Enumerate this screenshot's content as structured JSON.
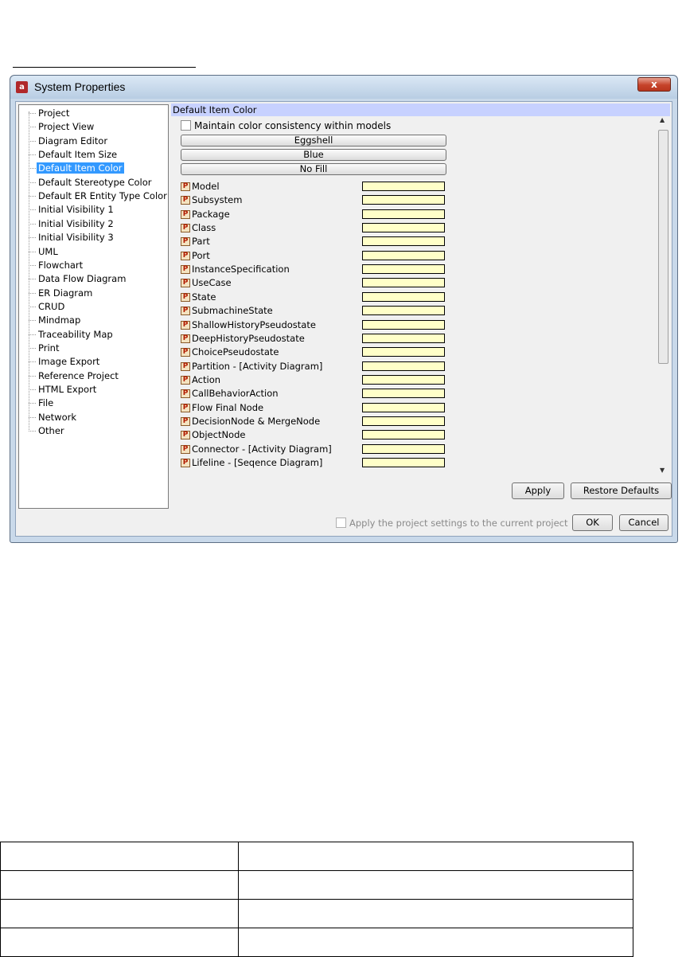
{
  "window": {
    "title": "System Properties",
    "app_icon": "astah-app-icon",
    "close_label": "x"
  },
  "tree": {
    "items": [
      {
        "label": "Project"
      },
      {
        "label": "Project View"
      },
      {
        "label": "Diagram Editor"
      },
      {
        "label": "Default Item Size"
      },
      {
        "label": "Default Item Color",
        "selected": true
      },
      {
        "label": "Default Stereotype Color"
      },
      {
        "label": "Default ER Entity Type Color"
      },
      {
        "label": "Initial Visibility 1"
      },
      {
        "label": "Initial Visibility 2"
      },
      {
        "label": "Initial Visibility 3"
      },
      {
        "label": "UML"
      },
      {
        "label": "Flowchart"
      },
      {
        "label": "Data Flow Diagram"
      },
      {
        "label": "ER Diagram"
      },
      {
        "label": "CRUD"
      },
      {
        "label": "Mindmap"
      },
      {
        "label": "Traceability Map"
      },
      {
        "label": "Print"
      },
      {
        "label": "Image Export"
      },
      {
        "label": "Reference Project"
      },
      {
        "label": "HTML Export"
      },
      {
        "label": "File"
      },
      {
        "label": "Network"
      },
      {
        "label": "Other"
      }
    ]
  },
  "panel": {
    "header": "Default Item Color",
    "consistency_checkbox": {
      "label": "Maintain color consistency within models",
      "checked": false
    },
    "color_buttons": [
      "Eggshell",
      "Blue",
      "No Fill"
    ],
    "items": [
      {
        "label": "Model",
        "color": "#ffffc8"
      },
      {
        "label": "Subsystem",
        "color": "#ffffc8"
      },
      {
        "label": "Package",
        "color": "#ffffc8"
      },
      {
        "label": "Class",
        "color": "#ffffc8"
      },
      {
        "label": "Part",
        "color": "#ffffc8"
      },
      {
        "label": "Port",
        "color": "#ffffc8"
      },
      {
        "label": "InstanceSpecification",
        "color": "#ffffc8"
      },
      {
        "label": "UseCase",
        "color": "#ffffc8"
      },
      {
        "label": "State",
        "color": "#ffffc8"
      },
      {
        "label": "SubmachineState",
        "color": "#ffffc8"
      },
      {
        "label": "ShallowHistoryPseudostate",
        "color": "#ffffc8"
      },
      {
        "label": "DeepHistoryPseudostate",
        "color": "#ffffc8"
      },
      {
        "label": "ChoicePseudostate",
        "color": "#ffffc8"
      },
      {
        "label": "Partition - [Activity Diagram]",
        "color": "#ffffc8"
      },
      {
        "label": "Action",
        "color": "#ffffc8"
      },
      {
        "label": "CallBehaviorAction",
        "color": "#ffffc8"
      },
      {
        "label": "Flow Final Node",
        "color": "#ffffc8"
      },
      {
        "label": "DecisionNode & MergeNode",
        "color": "#ffffc8"
      },
      {
        "label": "ObjectNode",
        "color": "#ffffc8"
      },
      {
        "label": "Connector - [Activity Diagram]",
        "color": "#ffffc8"
      },
      {
        "label": "Lifeline - [Seqence Diagram]",
        "color": "#ffffc8"
      }
    ],
    "item_icon_glyph": "P",
    "apply_label": "Apply",
    "restore_label": "Restore Defaults"
  },
  "footer": {
    "apply_project_checkbox": {
      "label": "Apply the project settings to the current project",
      "checked": false,
      "enabled": false
    },
    "ok_label": "OK",
    "cancel_label": "Cancel"
  },
  "colors": {
    "selection": "#3399ff",
    "panel_header": "#c7d1ff",
    "swatch": "#ffffc8"
  }
}
